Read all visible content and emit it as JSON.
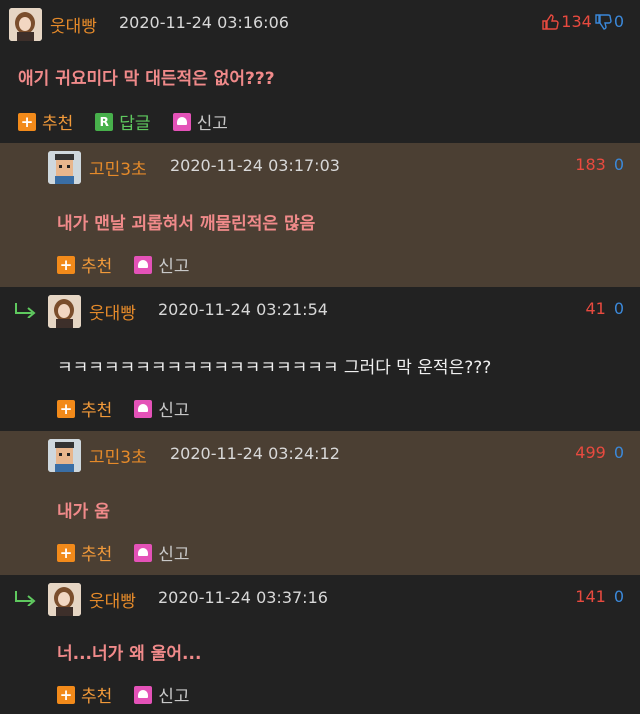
{
  "comments": [
    {
      "nick": "웃대빵",
      "time": "2020-11-24 03:16:06",
      "up": "134",
      "down": "0",
      "text": "애기 귀요미다 막 대든적은 없어???",
      "recommend": "추천",
      "reply": "답글",
      "report": "신고"
    },
    {
      "nick": "고민3초",
      "time": "2020-11-24 03:17:03",
      "up": "183",
      "down": "0",
      "text": "내가 맨날 괴롭혀서 깨물린적은 많음",
      "recommend": "추천",
      "report": "신고"
    },
    {
      "nick": "웃대빵",
      "time": "2020-11-24 03:21:54",
      "up": "41",
      "down": "0",
      "text": "ㅋㅋㅋㅋㅋㅋㅋㅋㅋㅋㅋㅋㅋㅋㅋㅋㅋㅋ 그러다 막 운적은???",
      "recommend": "추천",
      "report": "신고"
    },
    {
      "nick": "고민3초",
      "time": "2020-11-24 03:24:12",
      "up": "499",
      "down": "0",
      "text": "내가 움",
      "recommend": "추천",
      "report": "신고"
    },
    {
      "nick": "웃대빵",
      "time": "2020-11-24 03:37:16",
      "up": "141",
      "down": "0",
      "text": "너...너가 왜 울어...",
      "recommend": "추천",
      "report": "신고"
    }
  ],
  "colors": {
    "dark_bg": "#222222",
    "brown_bg": "#4b3f33",
    "nick": "#e58a2a",
    "upvote": "#e84a3f",
    "downvote": "#3b88d9",
    "comment_text": "#f08a8a"
  },
  "icons": [
    "thumbs-up-icon",
    "thumbs-down-icon",
    "reply-arrow-icon",
    "plus-icon",
    "reply-r-icon",
    "report-siren-icon"
  ]
}
